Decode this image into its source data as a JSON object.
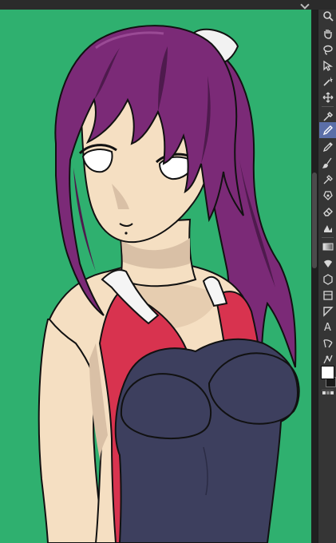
{
  "colors": {
    "canvas_bg": "#2fb06f",
    "hair": "#7b2a77",
    "hair_shadow": "#4e1a4d",
    "skin": "#f5dfc2",
    "skin_shadow": "#d9c0a6",
    "swimsuit_navy": "#3d3f5e",
    "swimsuit_red": "#d8334f",
    "strap_white": "#f5f5f5",
    "line_black": "#111111",
    "toolbar_bg": "#353535",
    "active_tool": "#5b6fa8",
    "main_color": "#ffffff",
    "sub_color": "#1a1a1a"
  },
  "toolbar": {
    "tools": [
      {
        "id": "zoom",
        "icon": "search-icon"
      },
      {
        "id": "hand",
        "icon": "hand-icon"
      },
      {
        "id": "rotate",
        "icon": "rotate-icon"
      },
      {
        "id": "select",
        "icon": "arrow-cursor-icon"
      },
      {
        "id": "lasso",
        "icon": "lasso-icon"
      },
      {
        "id": "object",
        "icon": "object-select-icon"
      },
      {
        "id": "magic_wand",
        "icon": "magic-wand-icon"
      },
      {
        "id": "move",
        "icon": "move-layer-icon"
      },
      {
        "id": "eyedropper",
        "icon": "eyedropper-icon"
      },
      {
        "id": "pen",
        "icon": "pen-icon"
      },
      {
        "id": "pencil",
        "icon": "pencil-icon"
      },
      {
        "id": "brush",
        "icon": "brush-icon"
      },
      {
        "id": "airbrush",
        "icon": "airbrush-icon"
      },
      {
        "id": "blend",
        "icon": "blend-icon"
      },
      {
        "id": "eraser",
        "icon": "eraser-icon"
      },
      {
        "id": "fill",
        "icon": "fill-bucket-icon"
      },
      {
        "id": "gradient",
        "icon": "gradient-icon"
      },
      {
        "id": "shape",
        "icon": "shape-icon"
      },
      {
        "id": "frame",
        "icon": "frame-icon"
      },
      {
        "id": "ruler",
        "icon": "ruler-icon"
      },
      {
        "id": "text",
        "icon": "text-icon",
        "glyph": "A"
      },
      {
        "id": "balloon",
        "icon": "balloon-icon"
      },
      {
        "id": "correct_line",
        "icon": "correct-line-icon"
      }
    ],
    "active_tool": "pen"
  }
}
